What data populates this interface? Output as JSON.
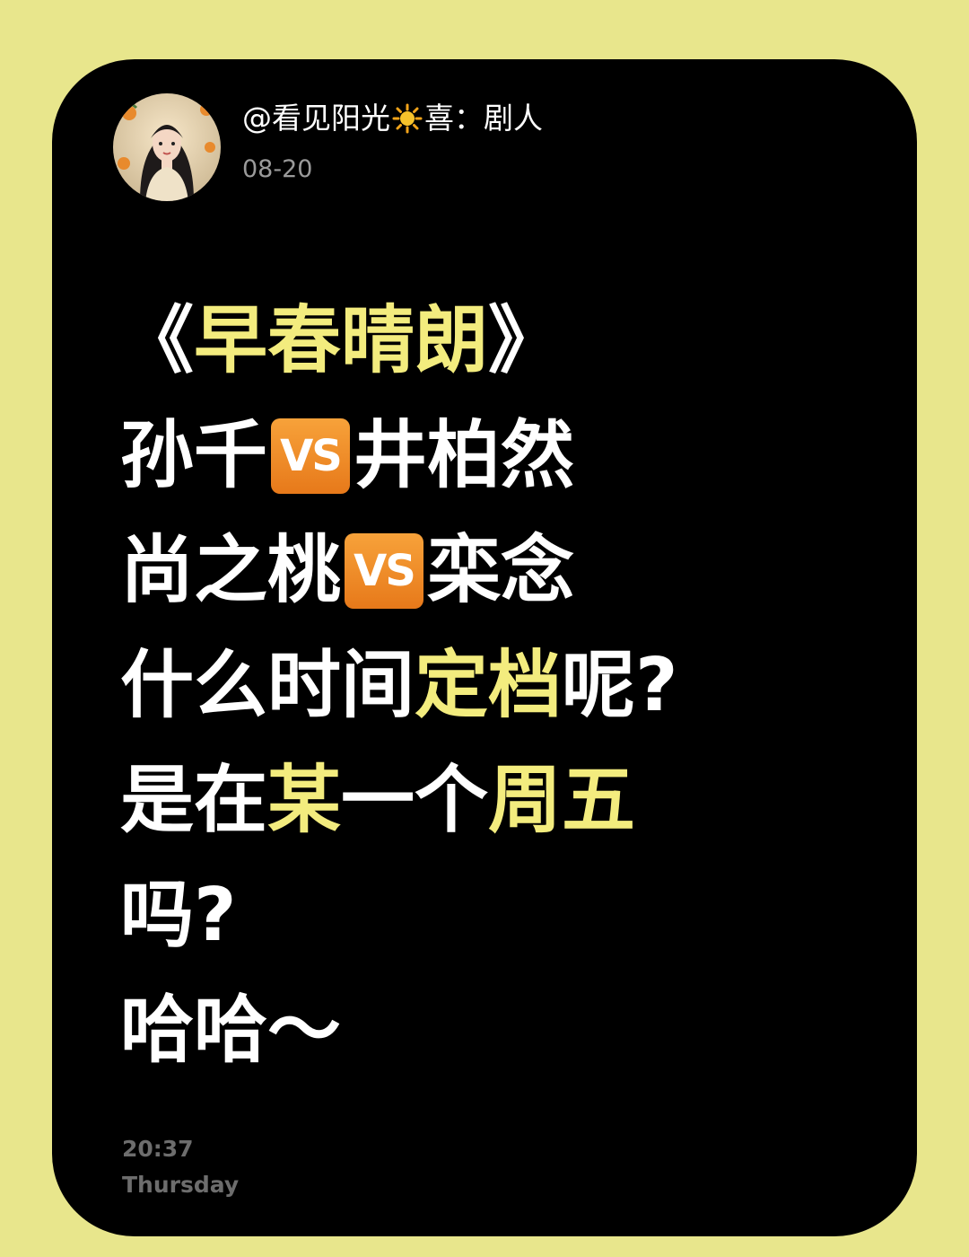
{
  "post": {
    "username_prefix": "@看见阳光",
    "username_sun_icon": "sun-icon",
    "username_suffix": "喜：剧人",
    "date": "08-20"
  },
  "content": {
    "line1": {
      "open_bracket": "《",
      "title": "早春晴朗",
      "close_bracket": "》"
    },
    "line2": {
      "left": "孙千",
      "vs": "VS",
      "right": "井柏然"
    },
    "line3": {
      "left": "尚之桃",
      "vs": "VS",
      "right": "栾念"
    },
    "line4": {
      "a": "什么时间",
      "b": "定档",
      "c": "呢?"
    },
    "line5": {
      "a": "是在",
      "b": "某",
      "c": "一个",
      "d": "周五"
    },
    "line6": "吗?",
    "line7": "哈哈～"
  },
  "footer": {
    "time": "20:37",
    "day": "Thursday"
  },
  "colors": {
    "background": "#e8e68c",
    "card": "#000000",
    "highlight": "#f3ec7e",
    "vs_badge": "#ef8c29"
  }
}
